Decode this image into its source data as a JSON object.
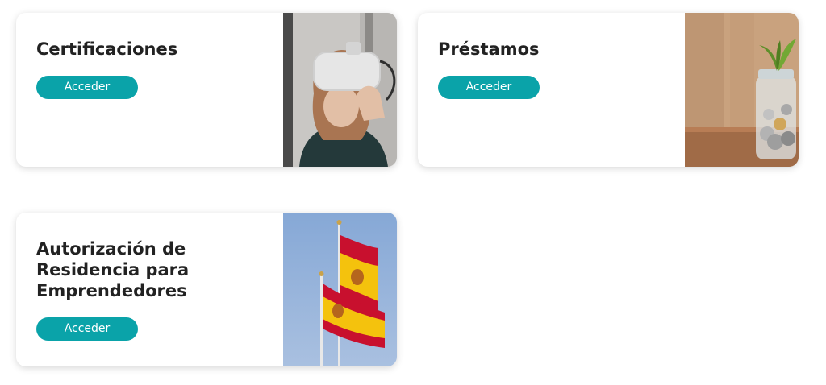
{
  "theme": {
    "accent": "#0aa3a9",
    "title_color": "#222222"
  },
  "cards": [
    {
      "title": "Certificaciones",
      "button_label": "Acceder",
      "image_icon": "woman-vr-headset-photo"
    },
    {
      "title": "Préstamos",
      "button_label": "Acceder",
      "image_icon": "coin-jar-plant-photo"
    },
    {
      "title": "Autorización de Residencia para Emprendedores",
      "button_label": "Acceder",
      "image_icon": "spanish-flags-photo"
    }
  ]
}
